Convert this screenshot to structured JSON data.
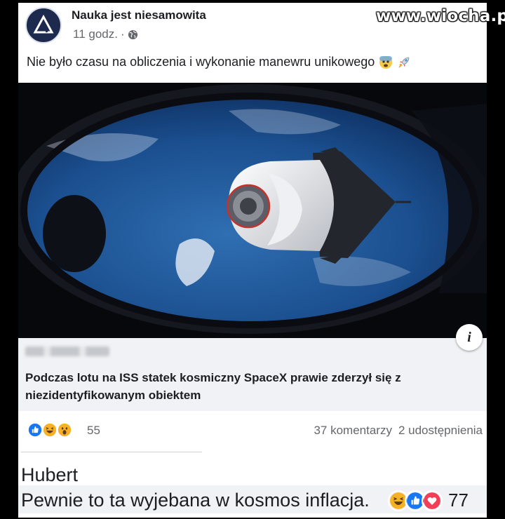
{
  "watermark": "www.wiocha.pl",
  "post": {
    "page_name": "Nauka jest niesamowita",
    "time": "11 godz.",
    "separator": "·",
    "privacy_icon": "globe-icon",
    "text": "Nie było czasu na obliczenia i wykonanie manewru unikowego",
    "text_emojis": [
      "scared-emoji",
      "rocket-emoji"
    ]
  },
  "link_preview": {
    "domain_blurred": true,
    "title": "Podczas lotu na ISS statek kosmiczny SpaceX prawie zderzył się z niezidentyfikowanym obiektem",
    "info_icon": "i"
  },
  "reactions": {
    "icons": [
      "like",
      "haha",
      "wow"
    ],
    "count": "55",
    "comments": "37 komentarzy",
    "shares": "2 udostępnienia"
  },
  "comment": {
    "author": "Hubert",
    "text": "Pewnie to ta wyjebana w kosmos inflacja.",
    "reaction_icons": [
      "haha",
      "like",
      "love"
    ],
    "reaction_count": "77"
  },
  "colors": {
    "like": "#1877f2",
    "love": "#f33e58",
    "haha": "#f7b125",
    "muted_text": "#65676b"
  }
}
